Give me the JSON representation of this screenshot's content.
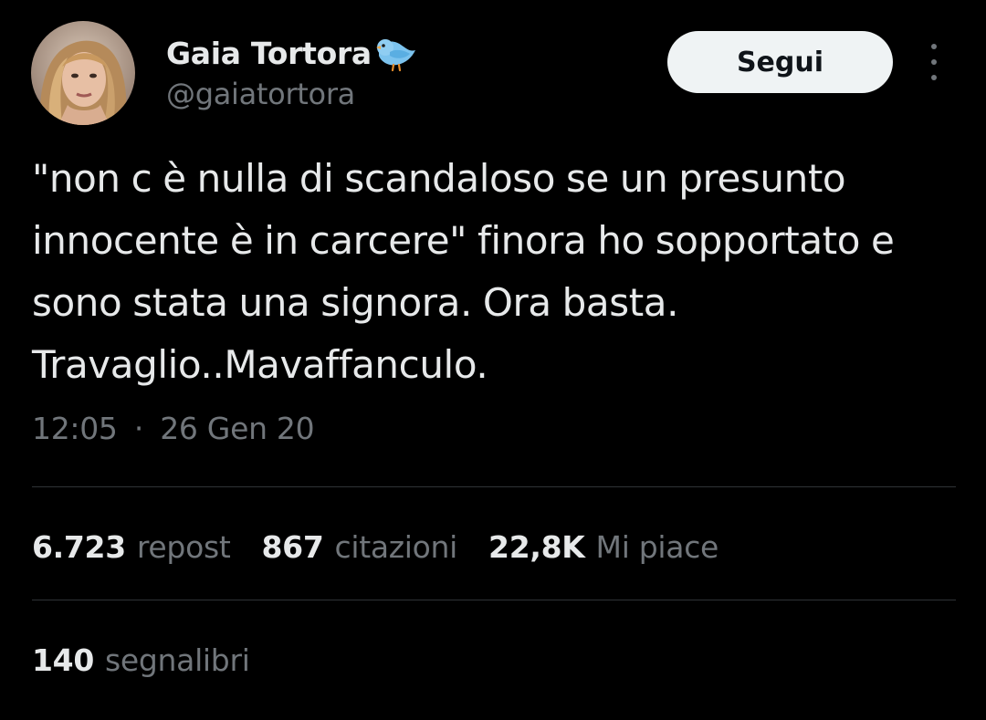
{
  "author": {
    "display_name": "Gaia Tortora",
    "handle": "@gaiatortora",
    "avatar_icon": "profile-photo",
    "badge_icon": "bird-emoji-icon"
  },
  "follow_button": {
    "label": "Segui"
  },
  "more_menu": {
    "icon": "more-vertical-icon"
  },
  "tweet": {
    "text": "\"non c è nulla di scandaloso se un presunto innocente è in carcere\" finora ho sopportato e sono stata una signora. Ora basta. Travaglio..Mavaffanculo.",
    "time": "12:05",
    "separator": "·",
    "date": "26 Gen 20"
  },
  "stats": {
    "reposts_value": "6.723",
    "reposts_label": "repost",
    "quotes_value": "867",
    "quotes_label": "citazioni",
    "likes_value": "22,8K",
    "likes_label": "Mi piace",
    "bookmarks_value": "140",
    "bookmarks_label": "segnalibri"
  },
  "colors": {
    "background": "#000000",
    "primary_text": "#e7e9ea",
    "secondary_text": "#71767b",
    "divider": "#2f3336",
    "button_bg": "#eff3f4",
    "button_text": "#0f1419"
  }
}
